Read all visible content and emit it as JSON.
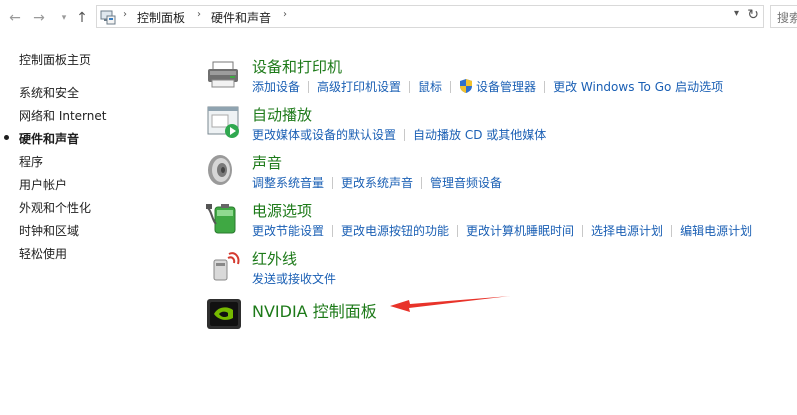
{
  "address": {
    "crumbs": [
      "控制面板",
      "硬件和声音"
    ],
    "separator": "›",
    "search_placeholder": "搜索"
  },
  "sidebar": {
    "items": [
      {
        "label": "控制面板主页",
        "active": false
      },
      {
        "label": "系统和安全",
        "active": false
      },
      {
        "label": "网络和 Internet",
        "active": false
      },
      {
        "label": "硬件和声音",
        "active": true
      },
      {
        "label": "程序",
        "active": false
      },
      {
        "label": "用户帐户",
        "active": false
      },
      {
        "label": "外观和个性化",
        "active": false
      },
      {
        "label": "时钟和区域",
        "active": false
      },
      {
        "label": "轻松使用",
        "active": false
      }
    ]
  },
  "categories": [
    {
      "title": "设备和打印机",
      "icon": "printer-icon",
      "links": [
        "添加设备",
        "高级打印机设置",
        "鼠标",
        "设备管理器",
        "更改 Windows To Go 启动选项"
      ]
    },
    {
      "title": "自动播放",
      "icon": "autoplay-icon",
      "links": [
        "更改媒体或设备的默认设置",
        "自动播放 CD 或其他媒体"
      ]
    },
    {
      "title": "声音",
      "icon": "speaker-icon",
      "links": [
        "调整系统音量",
        "更改系统声音",
        "管理音频设备"
      ]
    },
    {
      "title": "电源选项",
      "icon": "battery-icon",
      "links": [
        "更改节能设置",
        "更改电源按钮的功能",
        "更改计算机睡眠时间",
        "选择电源计划",
        "编辑电源计划"
      ]
    },
    {
      "title": "红外线",
      "icon": "infrared-icon",
      "links": [
        "发送或接收文件"
      ]
    },
    {
      "title": "NVIDIA 控制面板",
      "icon": "nvidia-icon",
      "links": []
    }
  ]
}
